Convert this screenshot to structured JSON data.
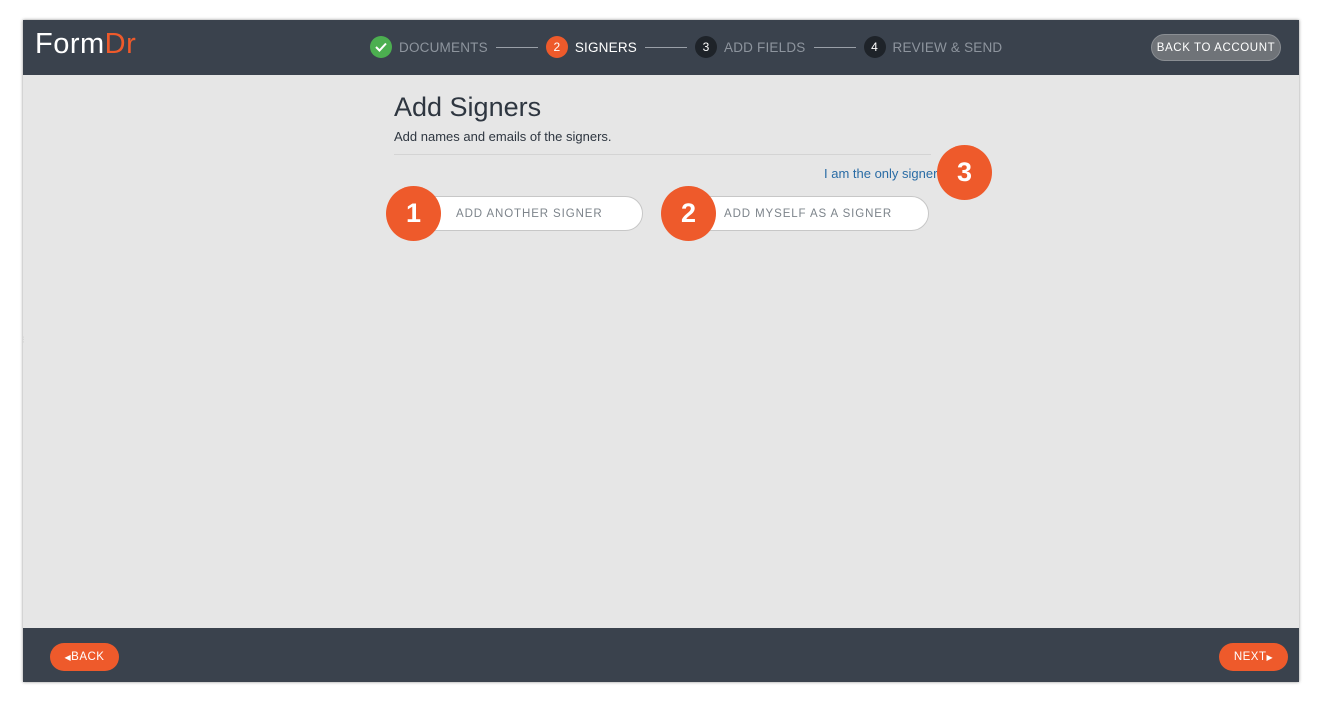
{
  "logo": {
    "part1": "Form",
    "part2": "Dr"
  },
  "stepper": {
    "steps": [
      {
        "number": "",
        "label": "DOCUMENTS",
        "status": "done",
        "icon": "check-icon"
      },
      {
        "number": "2",
        "label": "SIGNERS",
        "status": "active"
      },
      {
        "number": "3",
        "label": "ADD FIELDS",
        "status": "pending"
      },
      {
        "number": "4",
        "label": "REVIEW & SEND",
        "status": "pending"
      }
    ]
  },
  "header": {
    "back_to_account": "BACK TO ACCOUNT"
  },
  "main": {
    "title": "Add Signers",
    "subtitle": "Add names and emails of the signers.",
    "only_signer_link": "I am the only signer",
    "add_another_signer": "ADD ANOTHER SIGNER",
    "add_myself": "ADD MYSELF AS A SIGNER"
  },
  "callouts": {
    "one": "1",
    "two": "2",
    "three": "3"
  },
  "footer": {
    "back": "BACK",
    "next": "NEXT",
    "back_icon": "caret-left-icon",
    "next_icon": "caret-right-icon"
  },
  "colors": {
    "bar": "#3a424d",
    "accent": "#ee5a2b",
    "done": "#4caf50",
    "link": "#2a6ca5",
    "background": "#e6e6e6"
  }
}
